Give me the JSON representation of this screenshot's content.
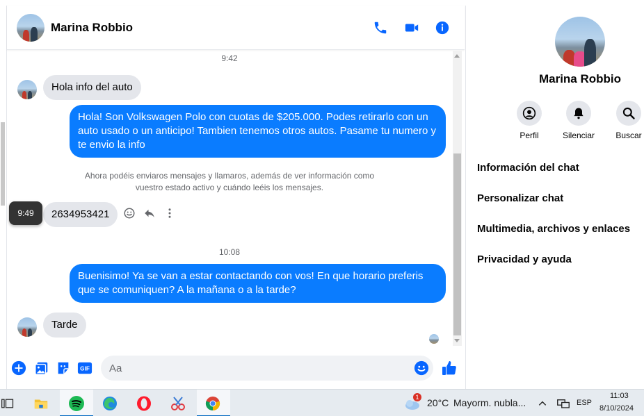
{
  "colors": {
    "accent": "#0a7cff",
    "bubble_in": "#e4e6eb",
    "messenger_blue": "#0866ff"
  },
  "chat": {
    "contact_name": "Marina Robbio",
    "header_icons": [
      "phone-icon",
      "video-icon",
      "info-icon"
    ],
    "time_1": "9:42",
    "msg_in_1": "Hola info del auto",
    "msg_out_1": "Hola! Son Volkswagen Polo con cuotas de $205.000. Podes retirarlo con un auto usado o un anticipo! Tambien tenemos otros autos. Pasame tu numero y te envio la info",
    "notice_line_1": "Ahora podéis enviaros mensajes y llamaros, además de ver información como",
    "notice_line_2": "vuestro estado activo y cuándo leéis los mensajes.",
    "tooltip_time": "9:49",
    "msg_in_2": "2634953421",
    "time_2": "10:08",
    "msg_out_2": "Buenisimo! Ya se van a estar contactando con vos! En que horario preferis que se comuniquen? A la mañana o a la tarde?",
    "msg_in_3": "Tarde"
  },
  "composer": {
    "placeholder": "Aa"
  },
  "info_panel": {
    "name": "Marina Robbio",
    "actions": [
      {
        "label": "Perfil",
        "icon": "profile-icon"
      },
      {
        "label": "Silenciar",
        "icon": "bell-icon"
      },
      {
        "label": "Buscar",
        "icon": "search-icon"
      }
    ],
    "items": [
      "Información del chat",
      "Personalizar chat",
      "Multimedia, archivos y enlaces",
      "Privacidad y ayuda"
    ]
  },
  "taskbar": {
    "weather_badge": "1",
    "weather_temp": "20°C",
    "weather_desc": "Mayorm. nubla...",
    "lang": "ESP",
    "time": "11:03",
    "date": "8/10/2024"
  }
}
